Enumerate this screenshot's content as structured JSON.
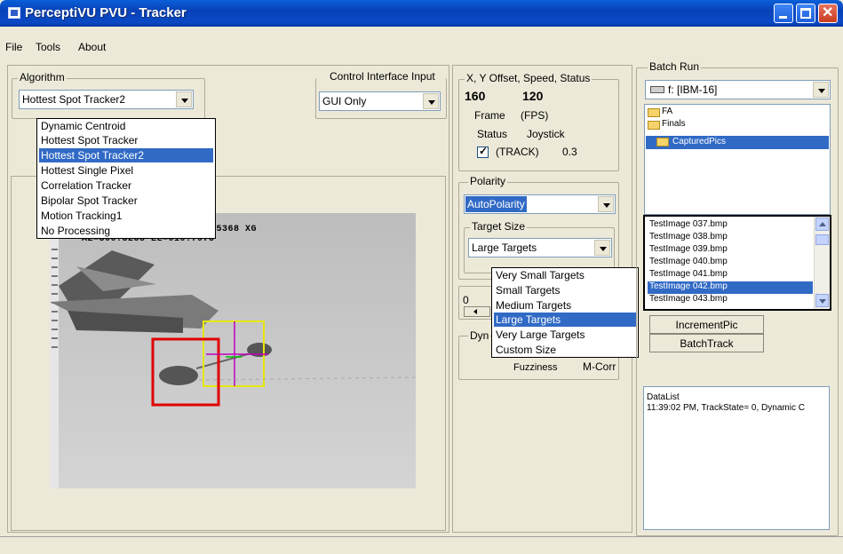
{
  "window": {
    "title": "PerceptiVU  PVU - Tracker"
  },
  "menu": {
    "file": "File",
    "tools": "Tools",
    "about": "About"
  },
  "algorithm": {
    "legend": "Algorithm",
    "selected": "Hottest Spot Tracker2",
    "options": [
      "Dynamic Centroid",
      "Hottest Spot Tracker",
      "Hottest Spot Tracker2",
      "Hottest Single Pixel",
      "Correlation Tracker",
      "Bipolar Spot Tracker",
      "Motion Tracking1",
      "No Processing"
    ],
    "highlighted_index": 2
  },
  "control_interface": {
    "legend": "Control Interface Input",
    "selected": "GUI Only"
  },
  "offset_panel": {
    "legend": "X, Y Offset, Speed, Status",
    "x": "160",
    "y": "120",
    "frame_label": "Frame",
    "fps_label": "(FPS)",
    "status_label": "Status",
    "joystick_label": "Joystick",
    "track_label": "(TRACK)",
    "joystick_value": "0.3"
  },
  "video": {
    "overlay_line1": "01.5368 XG",
    "overlay_line2": "AZ=300.3255 EL=010.7975"
  },
  "polarity": {
    "legend": "Polarity",
    "selected": "AutoPolarity"
  },
  "target_size": {
    "legend": "Target Size",
    "selected": "Large Targets",
    "options": [
      "Very Small Targets",
      "Small Targets",
      "Medium Targets",
      "Large Targets",
      "Very Large Targets",
      "Custom Size"
    ],
    "highlighted_index": 3
  },
  "slider_panel": {
    "value": "0"
  },
  "dyn_panel": {
    "legend": "Dyn",
    "fuzziness": "Fuzziness",
    "mcorr": "M-Corr"
  },
  "batch": {
    "legend": "Batch Run",
    "drive": "f: [IBM-16]",
    "folders": [
      "FA",
      "Finals",
      "CapturedPics"
    ],
    "files": [
      "TestImage 037.bmp",
      "TestImage 038.bmp",
      "TestImage 039.bmp",
      "TestImage 040.bmp",
      "TestImage 041.bmp",
      "TestImage 042.bmp",
      "TestImage 043.bmp"
    ],
    "selected_file_index": 5,
    "increment_label": "IncrementPic",
    "batchtrack_label": "BatchTrack"
  },
  "datalist": {
    "title": "DataList",
    "line1": "11:39:02 PM, TrackState= 0, Dynamic C"
  },
  "colors": {
    "title_blue": "#0842b8",
    "selection": "#316ac5",
    "track_box_red": "#e00000",
    "track_box_yellow": "#e8e800",
    "crosshair": "#c000c0"
  }
}
